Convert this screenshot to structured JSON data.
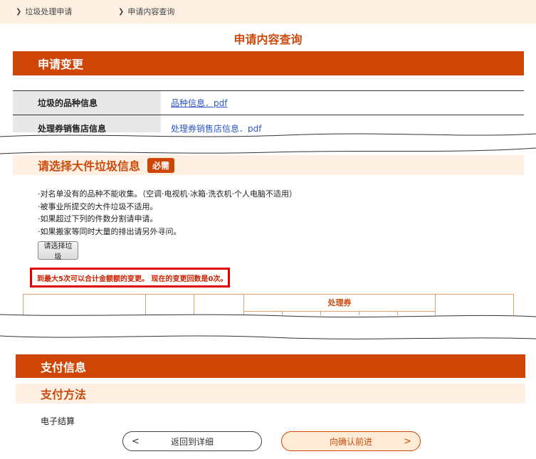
{
  "breadcrumb": {
    "items": [
      {
        "label": "垃圾处理申请"
      },
      {
        "label": "申请内容查询"
      }
    ]
  },
  "page_title": "申请内容查询",
  "section_change": {
    "title": "申请变更"
  },
  "info_rows": [
    {
      "label": "垃圾的品种信息",
      "link": "品种信息．pdf"
    },
    {
      "label": "处理券销售店信息",
      "link": "处理券销售店信息．pdf"
    }
  ],
  "select_section": {
    "title": "请选择大件垃圾信息",
    "badge": "必需",
    "notes": [
      "·对名单没有的品种不能收集。（空调·电视机·冰箱·洗衣机·个人电脑不适用）",
      "·被事业所提交的大件垃圾不适用。",
      "·如果超过下列的件数分割请申请。",
      "·如果搬家等同时大量的排出请另外寻问。"
    ],
    "select_button": "请选择垃圾",
    "warning": "到最大5次可以合计金额额的变更。 现在的变更回数是0次。"
  },
  "table": {
    "header_group": "处理券"
  },
  "payment": {
    "title": "支付信息",
    "method_title": "支付方法",
    "method_value": "电子结算"
  },
  "nav": {
    "back_label": "返回到详细",
    "back_icon": "<",
    "next_label": "向确认前进",
    "next_icon": ">"
  },
  "colors": {
    "accent": "#cf4506",
    "beige": "#fdf0e3",
    "warning_border": "#e00000",
    "link": "#2b56c4"
  }
}
